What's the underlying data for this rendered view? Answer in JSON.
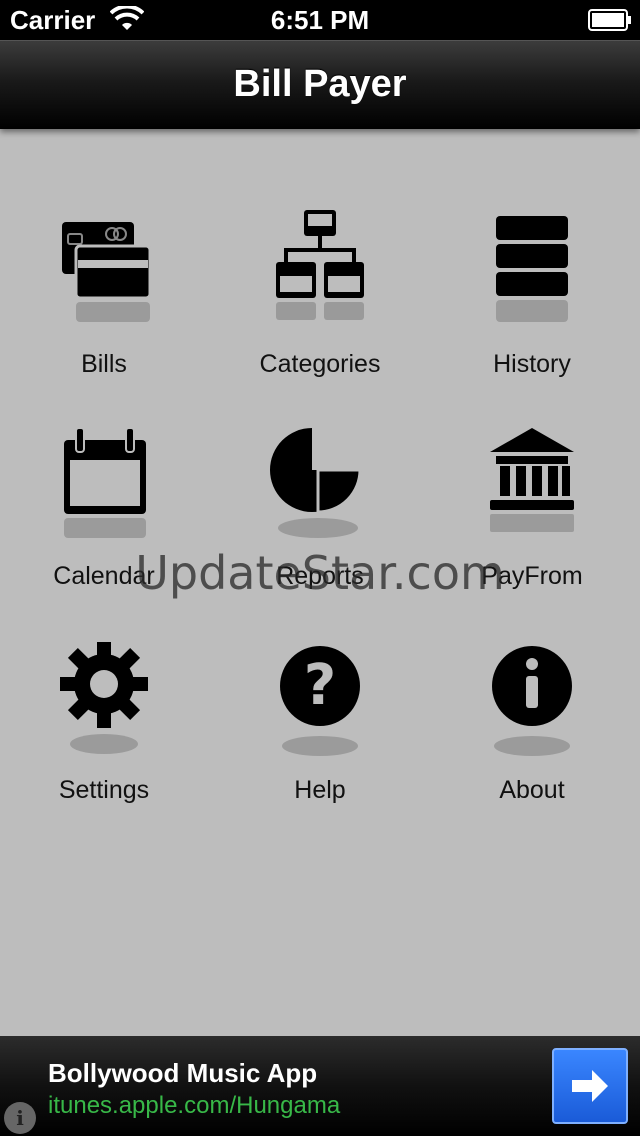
{
  "status_bar": {
    "carrier": "Carrier",
    "time": "6:51 PM"
  },
  "nav": {
    "title": "Bill Payer"
  },
  "menu": [
    {
      "label": "Bills",
      "icon": "credit-card-icon"
    },
    {
      "label": "Categories",
      "icon": "hierarchy-icon"
    },
    {
      "label": "History",
      "icon": "stack-icon"
    },
    {
      "label": "Calendar",
      "icon": "calendar-icon"
    },
    {
      "label": "Reports",
      "icon": "pie-chart-icon"
    },
    {
      "label": "PayFrom",
      "icon": "bank-icon"
    },
    {
      "label": "Settings",
      "icon": "gear-icon"
    },
    {
      "label": "Help",
      "icon": "question-icon"
    },
    {
      "label": "About",
      "icon": "info-icon"
    }
  ],
  "watermark": "UpdateStar.com",
  "ad": {
    "title": "Bollywood Music App",
    "url": "itunes.apple.com/Hungama",
    "info_glyph": "i"
  },
  "colors": {
    "background": "#bdbdbd",
    "ad_url": "#38b848",
    "ad_button": "#2a6ff0"
  }
}
